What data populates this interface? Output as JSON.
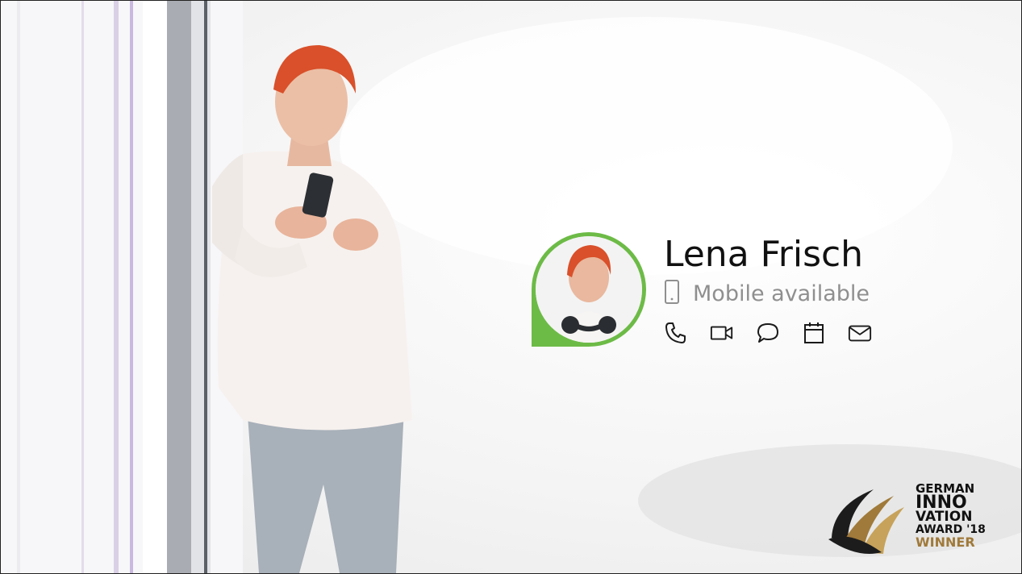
{
  "contact": {
    "name": "Lena Frisch",
    "status_text": "Mobile available",
    "presence_color": "#6dbb47",
    "status_icon": "mobile-phone-icon",
    "actions": [
      {
        "icon": "phone-icon"
      },
      {
        "icon": "video-camera-icon"
      },
      {
        "icon": "chat-bubble-icon"
      },
      {
        "icon": "calendar-icon"
      },
      {
        "icon": "mail-icon"
      }
    ]
  },
  "award": {
    "line1": "GERMAN",
    "line2": "INNO",
    "line3": "VATION",
    "line4": "AWARD '18",
    "line5": "WINNER",
    "gold_color": "#a07a3a"
  }
}
